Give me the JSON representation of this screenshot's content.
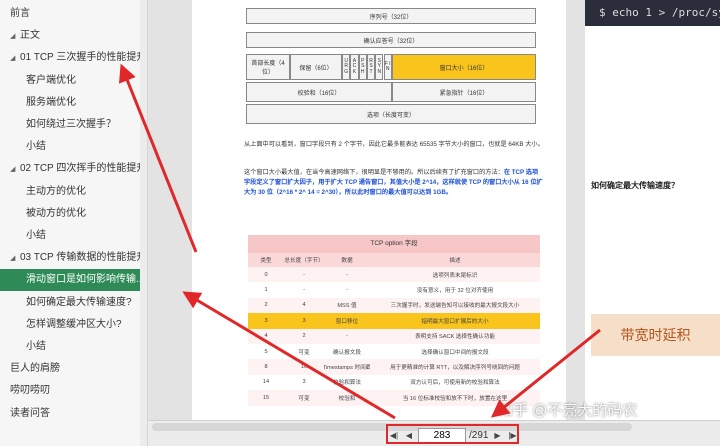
{
  "toc": [
    {
      "label": "前言",
      "level": 0,
      "arrow": false,
      "active": false
    },
    {
      "label": "正文",
      "level": 0,
      "arrow": true,
      "active": false
    },
    {
      "label": "01 TCP 三次握手的性能提升",
      "level": 1,
      "arrow": true,
      "active": false
    },
    {
      "label": "客户端优化",
      "level": 2,
      "arrow": false,
      "active": false
    },
    {
      "label": "服务端优化",
      "level": 2,
      "arrow": false,
      "active": false
    },
    {
      "label": "如何绕过三次握手？",
      "level": 2,
      "arrow": false,
      "active": false
    },
    {
      "label": "小结",
      "level": 2,
      "arrow": false,
      "active": false
    },
    {
      "label": "02 TCP 四次挥手的性能提升",
      "level": 1,
      "arrow": true,
      "active": false
    },
    {
      "label": "主动方的优化",
      "level": 2,
      "arrow": false,
      "active": false
    },
    {
      "label": "被动方的优化",
      "level": 2,
      "arrow": false,
      "active": false
    },
    {
      "label": "小结",
      "level": 2,
      "arrow": false,
      "active": false
    },
    {
      "label": "03 TCP 传输数据的性能提升",
      "level": 1,
      "arrow": true,
      "active": false
    },
    {
      "label": "滑动窗口是如何影响传输...",
      "level": 2,
      "arrow": false,
      "active": true
    },
    {
      "label": "如何确定最大传输速度?",
      "level": 2,
      "arrow": false,
      "active": false
    },
    {
      "label": "怎样调整缓冲区大小?",
      "level": 2,
      "arrow": false,
      "active": false
    },
    {
      "label": "小结",
      "level": 2,
      "arrow": false,
      "active": false
    },
    {
      "label": "巨人的肩膀",
      "level": 0,
      "arrow": false,
      "active": false
    },
    {
      "label": "唠叨唠叨",
      "level": 0,
      "arrow": false,
      "active": false
    },
    {
      "label": "读者问答",
      "level": 0,
      "arrow": false,
      "active": false
    }
  ],
  "header_diagram": {
    "seq": "序列号（32位）",
    "ack": "确认应答号（32位）",
    "hlen": "首部长度（4位）",
    "reserved": "保留（6位）",
    "flags": [
      "U R G",
      "A C K",
      "P S H",
      "R S T",
      "S Y N",
      "F I N"
    ],
    "window": "窗口大小（16位）",
    "checksum": "校验和（16位）",
    "urgent": "紧急指针（16位）",
    "options": "选项（长度可变）"
  },
  "paragraphs": {
    "p1": "从上面中可以看到，窗口字段只有 2 个字节，因此它最多能表达 65535 字节大小的窗口，也就是 64KB 大小。",
    "p2_plain": "这个窗口大小最大值，在当今高速网络下，很明显是不够用的。所以后续有了扩充窗口的方法：",
    "p2_blue": "在 TCP 选项字段定义了窗口扩大因子，用于扩大 TCP 通告窗口，其值大小是 2^14，这样就使 TCP 的窗口大小从 16 位扩大为 30 位（2^16 * 2^ 14 = 2^30），所以此时窗口的最大值可以达到 1GB。"
  },
  "option_table": {
    "title": "TCP option 字段",
    "headers": [
      "类型",
      "总长度（字节）",
      "数据",
      "描述"
    ],
    "rows": [
      [
        "0",
        "-",
        "-",
        "选项列表末尾标识"
      ],
      [
        "1",
        "-",
        "-",
        "没有意义，用于 32 位对齐使用"
      ],
      [
        "2",
        "4",
        "MSS 值",
        "三次握手时，发送端告知可以接收的最大报文段大小"
      ],
      [
        "3",
        "3",
        "窗口移位",
        "指明最大窗口扩展后的大小"
      ],
      [
        "4",
        "2",
        "-",
        "表明支持 SACK 选择性确认功能"
      ],
      [
        "5",
        "可变",
        "确认报文段",
        "选择确认窗口中间的报文段"
      ],
      [
        "8",
        "10",
        "Timestamps 时间戳",
        "用于更精准的计算 RTT，以及解决序列号绕回的问题"
      ],
      [
        "14",
        "3",
        "校验和算法",
        "双方认可后，可使用新的校验和算法"
      ],
      [
        "15",
        "可变",
        "校验和",
        "当 16 位标准校验和放不下时，放置在这里"
      ]
    ],
    "highlight_row": 3
  },
  "right_page": {
    "code": "$ echo 1 > /proc/sys",
    "head1": "如何确定最大传输速度？",
    "bandwidth_box": "带宽时延积"
  },
  "watermark": "知乎 @不亮大的码农",
  "pager": {
    "current_page": "283",
    "total_pages": "/291"
  },
  "colors": {
    "active_toc": "#2e8b57",
    "highlight": "#f9c41b",
    "arrow_red": "#e0282a",
    "table_header": "#f7c7c7"
  }
}
